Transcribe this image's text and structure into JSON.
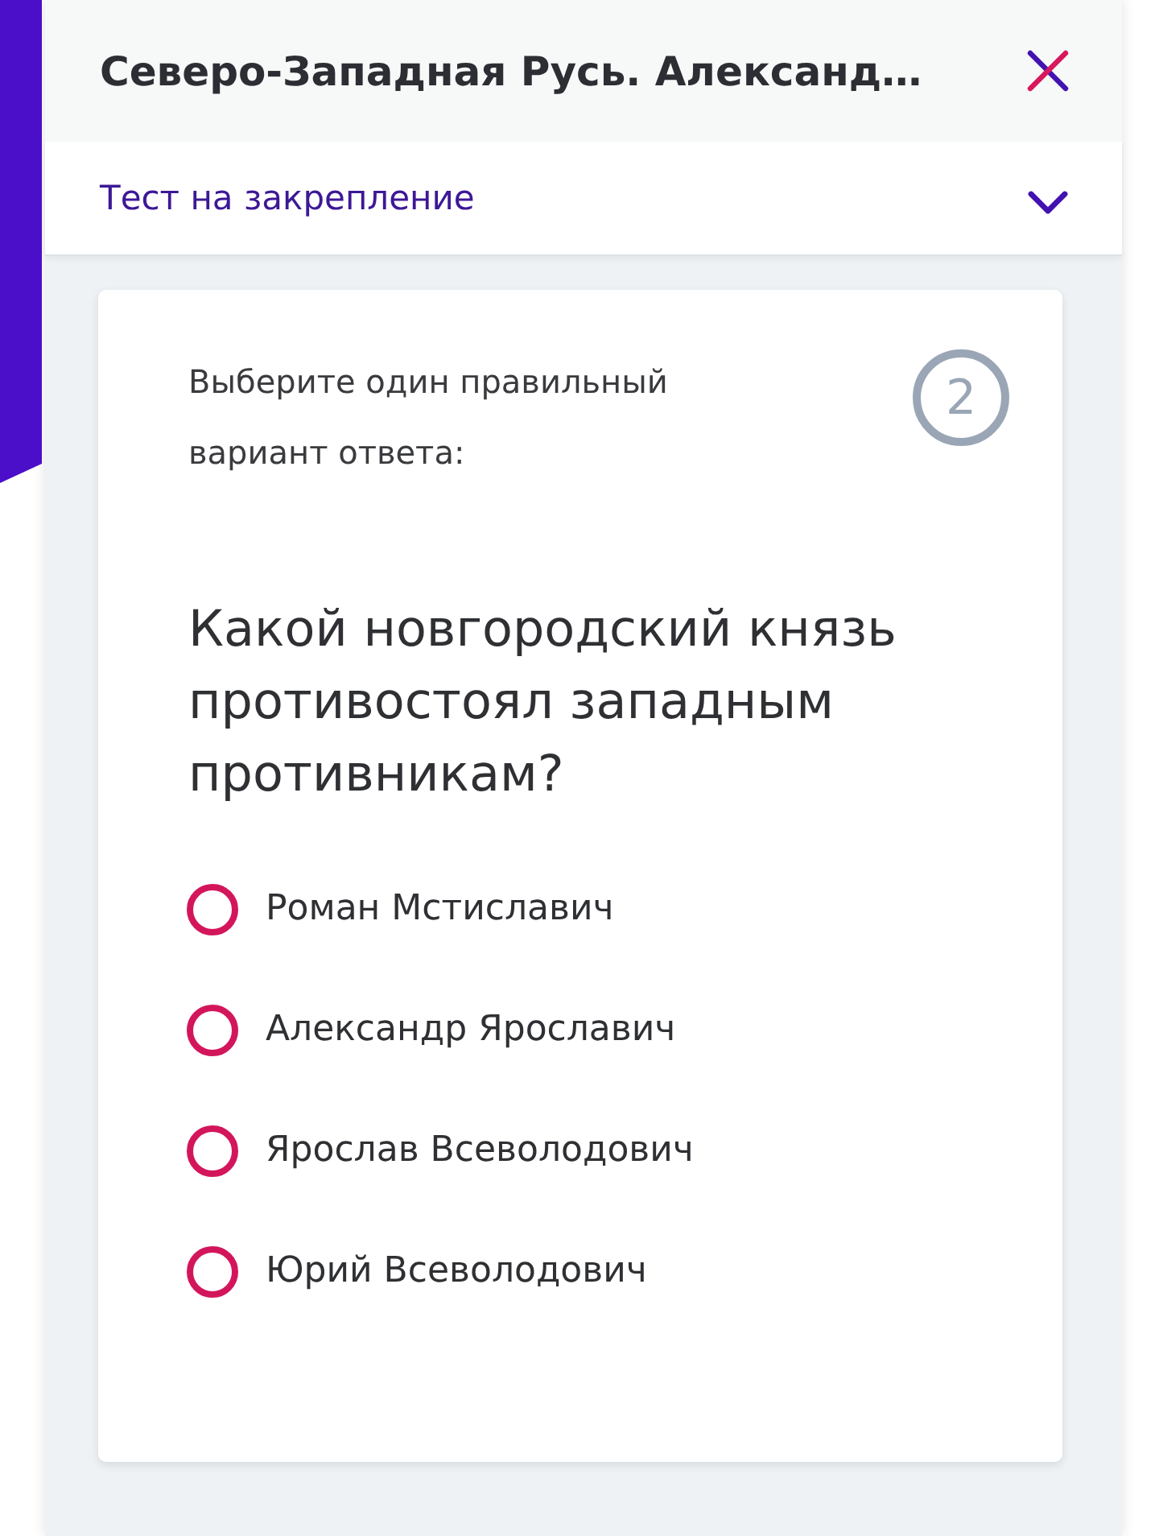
{
  "header": {
    "title": "Северо-Западная Русь. Александ…"
  },
  "section": {
    "title": "Тест на закрепление"
  },
  "question": {
    "instruction": "Выберите один правильный вариант ответа:",
    "number": "2",
    "text": "Какой новгородский князь противостоял западным противникам?",
    "options": [
      {
        "label": "Роман Мстиславич",
        "selected": false
      },
      {
        "label": "Александр Ярославич",
        "selected": false
      },
      {
        "label": "Ярослав Всеволодович",
        "selected": false
      },
      {
        "label": "Юрий Всеволодович",
        "selected": false
      }
    ]
  }
}
